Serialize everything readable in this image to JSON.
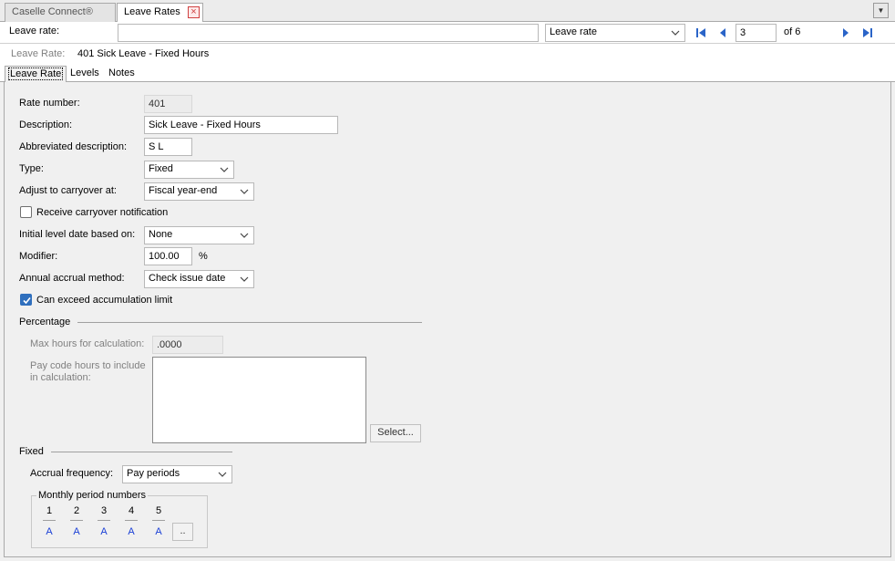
{
  "tabs": [
    {
      "label": "Caselle Connect®",
      "active": false
    },
    {
      "label": "Leave Rates",
      "active": true
    }
  ],
  "toolbar": {
    "search_label": "Leave rate:",
    "search_value": "",
    "search_field_select": "Leave rate",
    "record_number": "3",
    "record_of": "of 6"
  },
  "record": {
    "label": "Leave Rate:",
    "value": "401  Sick Leave - Fixed Hours"
  },
  "subtabs": [
    {
      "label": "Leave Rate",
      "active": true
    },
    {
      "label": "Levels",
      "active": false
    },
    {
      "label": "Notes",
      "active": false
    }
  ],
  "form": {
    "rate_number_label": "Rate number:",
    "rate_number_value": "401",
    "description_label": "Description:",
    "description_value": "Sick Leave - Fixed Hours",
    "abbrev_label": "Abbreviated description:",
    "abbrev_value": "S L",
    "type_label": "Type:",
    "type_value": "Fixed",
    "carryover_label": "Adjust to carryover at:",
    "carryover_value": "Fiscal year-end",
    "carryover_notify_label": "Receive carryover notification",
    "carryover_notify_checked": false,
    "initial_level_label": "Initial level date based on:",
    "initial_level_value": "None",
    "modifier_label": "Modifier:",
    "modifier_value": "100.00",
    "modifier_unit": "%",
    "annual_accrual_label": "Annual accrual method:",
    "annual_accrual_value": "Check issue date",
    "exceed_label": "Can exceed accumulation limit",
    "exceed_checked": true
  },
  "percentage": {
    "section_title": "Percentage",
    "max_hours_label": "Max hours for calculation:",
    "max_hours_value": ".0000",
    "pay_code_label_line1": "Pay code hours to include",
    "pay_code_label_line2": "in calculation:",
    "select_button": "Select..."
  },
  "fixed": {
    "section_title": "Fixed",
    "accrual_frequency_label": "Accrual frequency:",
    "accrual_frequency_value": "Pay periods",
    "monthly_group_title": "Monthly period numbers",
    "periods": [
      {
        "num": "1",
        "val": "A"
      },
      {
        "num": "2",
        "val": "A"
      },
      {
        "num": "3",
        "val": "A"
      },
      {
        "num": "4",
        "val": "A"
      },
      {
        "num": "5",
        "val": "A"
      }
    ],
    "more_button": ".."
  },
  "colors": {
    "accent": "#2f6fbd",
    "nav_icon": "#2a64c8",
    "period_value": "#1a3fd6",
    "close_icon": "#d04040"
  }
}
